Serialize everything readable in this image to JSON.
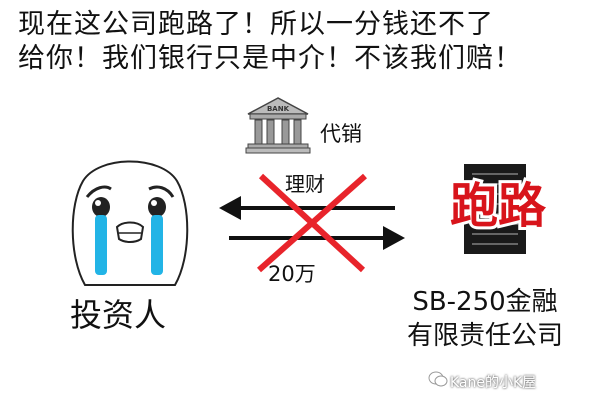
{
  "caption": {
    "line1": "现在这公司跑路了！所以一分钱还不了",
    "line2": "给你！我们银行只是中介！不该我们赔！"
  },
  "bank": {
    "sign": "BANK",
    "label": "代销"
  },
  "arrows": {
    "top_label": "理财",
    "bottom_label": "20万"
  },
  "investor": {
    "label": "投资人"
  },
  "company": {
    "stamp": "跑路",
    "line1": "SB-250金融",
    "line2": "有限责任公司"
  },
  "watermark": {
    "text": "Kane的小K屋"
  },
  "colors": {
    "tear": "#22b4e6",
    "cross": "#e8242b",
    "stamp_fill": "#d8141b"
  }
}
